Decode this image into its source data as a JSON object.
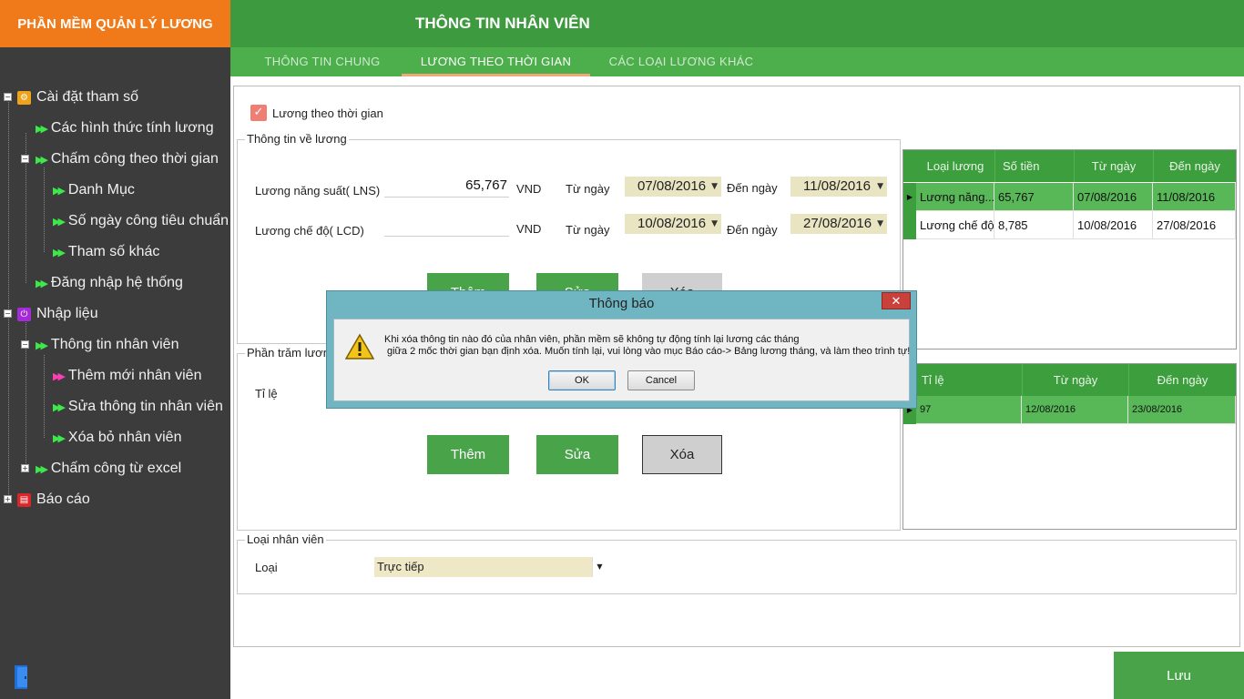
{
  "app": {
    "title": "PHẦN MỀM QUẢN LÝ LƯƠNG"
  },
  "header": {
    "title": "THÔNG TIN NHÂN VIÊN"
  },
  "tabs": [
    {
      "label": "THÔNG TIN CHUNG"
    },
    {
      "label": "LƯƠNG THEO THỜI GIAN"
    },
    {
      "label": "CÁC LOẠI LƯƠNG KHÁC"
    }
  ],
  "sidebar": {
    "items": [
      {
        "label": "Cài đặt tham số",
        "icon": "gear-icon"
      },
      {
        "label": "Các hình thức tính lương"
      },
      {
        "label": "Chấm công theo thời gian"
      },
      {
        "label": "Danh Mục"
      },
      {
        "label": "Số ngày công tiêu chuẩn"
      },
      {
        "label": "Tham số khác"
      },
      {
        "label": "Đăng nhập hệ thống"
      },
      {
        "label": "Nhập liệu",
        "icon": "power-icon"
      },
      {
        "label": "Thông tin nhân viên"
      },
      {
        "label": "Thêm mới nhân viên"
      },
      {
        "label": "Sửa thông tin nhân viên"
      },
      {
        "label": "Xóa bỏ nhân viên"
      },
      {
        "label": "Chấm công từ excel"
      },
      {
        "label": "Báo cáo",
        "icon": "report-icon"
      }
    ]
  },
  "form": {
    "checkbox_label": "Lương theo thời gian",
    "salary_group_label": "Thông tin về lương",
    "lns_label": "Lương năng suất( LNS)",
    "lns_value": "65,767",
    "lcd_label": "Lương chế độ( LCD)",
    "lcd_value": "",
    "currency": "VND",
    "from_label": "Từ ngày",
    "to_label": "Đến ngày",
    "lns_from": "07/08/2016",
    "lns_to": "11/08/2016",
    "lcd_from": "10/08/2016",
    "lcd_to": "27/08/2016",
    "percent_group_label": "Phần trăm lương",
    "ratio_label": "Tỉ lệ",
    "add_label": "Thêm",
    "edit_label": "Sửa",
    "delete_label": "Xóa",
    "employee_type_group_label": "Loại nhân viên",
    "type_label": "Loại",
    "type_value": "Trực tiếp"
  },
  "salary_grid": {
    "headers": [
      "Loại lương",
      "Số tiền",
      "Từ ngày",
      "Đến ngày"
    ],
    "rows": [
      [
        "Lương năng...",
        "65,767",
        "07/08/2016",
        "11/08/2016"
      ],
      [
        "Lương chế độ",
        "8,785",
        "10/08/2016",
        "27/08/2016"
      ]
    ]
  },
  "ratio_grid": {
    "headers": [
      "Tỉ lệ",
      "Từ ngày",
      "Đến ngày"
    ],
    "rows": [
      [
        "97",
        "12/08/2016",
        "23/08/2016"
      ]
    ]
  },
  "save_label": "Lưu",
  "dialog": {
    "title": "Thông báo",
    "message_line1": "Khi xóa thông tin nào đó của nhân viên, phần mềm sẽ không tự động tính lại lương các tháng",
    "message_line2": "giữa 2 mốc thời gian bạn định xóa. Muốn tính lại, vui lòng vào mục Báo cáo-> Bảng lương tháng, và làm theo trình tự!",
    "ok_label": "OK",
    "cancel_label": "Cancel",
    "close_glyph": "✕"
  },
  "colors": {
    "brand_orange": "#f07a1a",
    "header_green": "#3e9a3e",
    "sidebar_bg": "#3c3c3c"
  }
}
